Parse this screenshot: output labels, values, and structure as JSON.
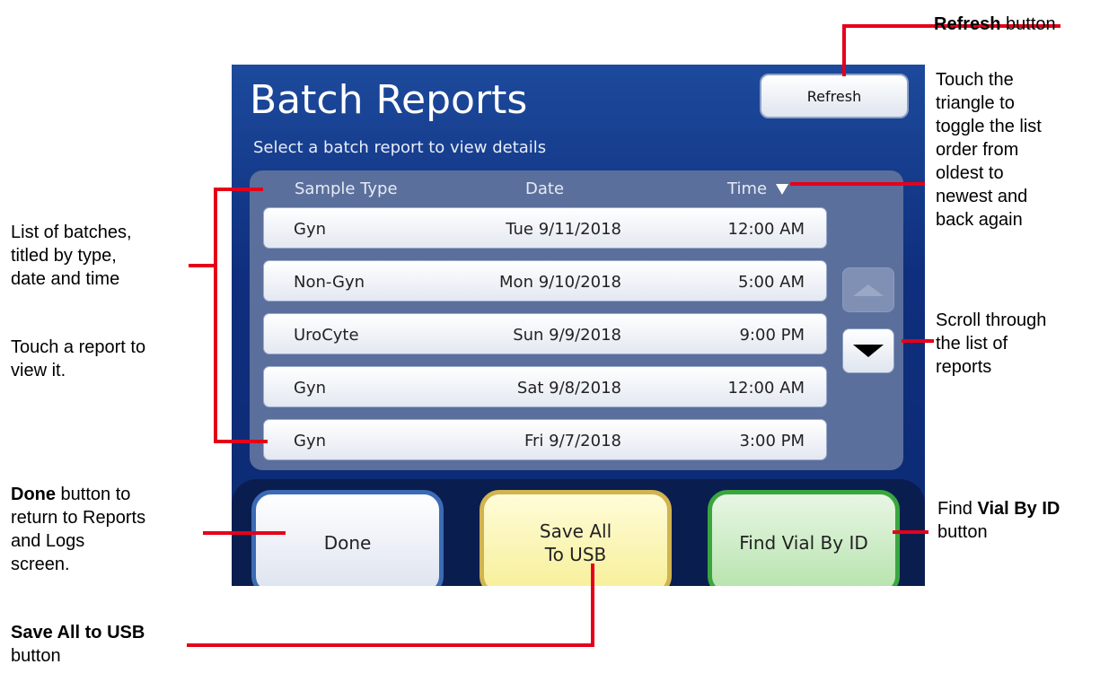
{
  "screen": {
    "title": "Batch Reports",
    "refresh_label": "Refresh",
    "subtitle": "Select a batch report to view details",
    "columns": {
      "type": "Sample Type",
      "date": "Date",
      "time": "Time"
    },
    "rows": [
      {
        "type": "Gyn",
        "date": "Tue 9/11/2018",
        "time": "12:00 AM"
      },
      {
        "type": "Non-Gyn",
        "date": "Mon 9/10/2018",
        "time": "5:00 AM"
      },
      {
        "type": "UroCyte",
        "date": "Sun 9/9/2018",
        "time": "9:00 PM"
      },
      {
        "type": "Gyn",
        "date": "Sat 9/8/2018",
        "time": "12:00 AM"
      },
      {
        "type": "Gyn",
        "date": "Fri 9/7/2018",
        "time": "3:00 PM"
      }
    ],
    "buttons": {
      "done": "Done",
      "save_line1": "Save All",
      "save_line2": "To USB",
      "find": "Find Vial By ID"
    },
    "colors": {
      "accent": "#0f2f7e",
      "done_border": "#3b6bb5",
      "save_border": "#d1b450",
      "find_border": "#3aa63e",
      "callout_line": "#e5001a"
    }
  },
  "annotations": {
    "refresh": {
      "bold": "Refresh",
      "rest": " button"
    },
    "triangle": [
      "Touch the",
      "triangle to",
      "toggle the list",
      "order from",
      "oldest to",
      "newest and",
      "back again"
    ],
    "list": [
      "List of batches,",
      "titled by type,",
      "date and time"
    ],
    "touch": [
      "Touch a report to",
      "view it."
    ],
    "scroll": [
      "Scroll through",
      "the list of",
      "reports"
    ],
    "done": {
      "bold": "Done",
      "rest": " button to",
      "lines": [
        "return to Reports",
        "and Logs",
        "screen."
      ]
    },
    "find": {
      "pre": "Find ",
      "bold": "Vial By ID",
      "line2": "button"
    },
    "save": {
      "bold": "Save All to USB",
      "line2": "button"
    }
  }
}
